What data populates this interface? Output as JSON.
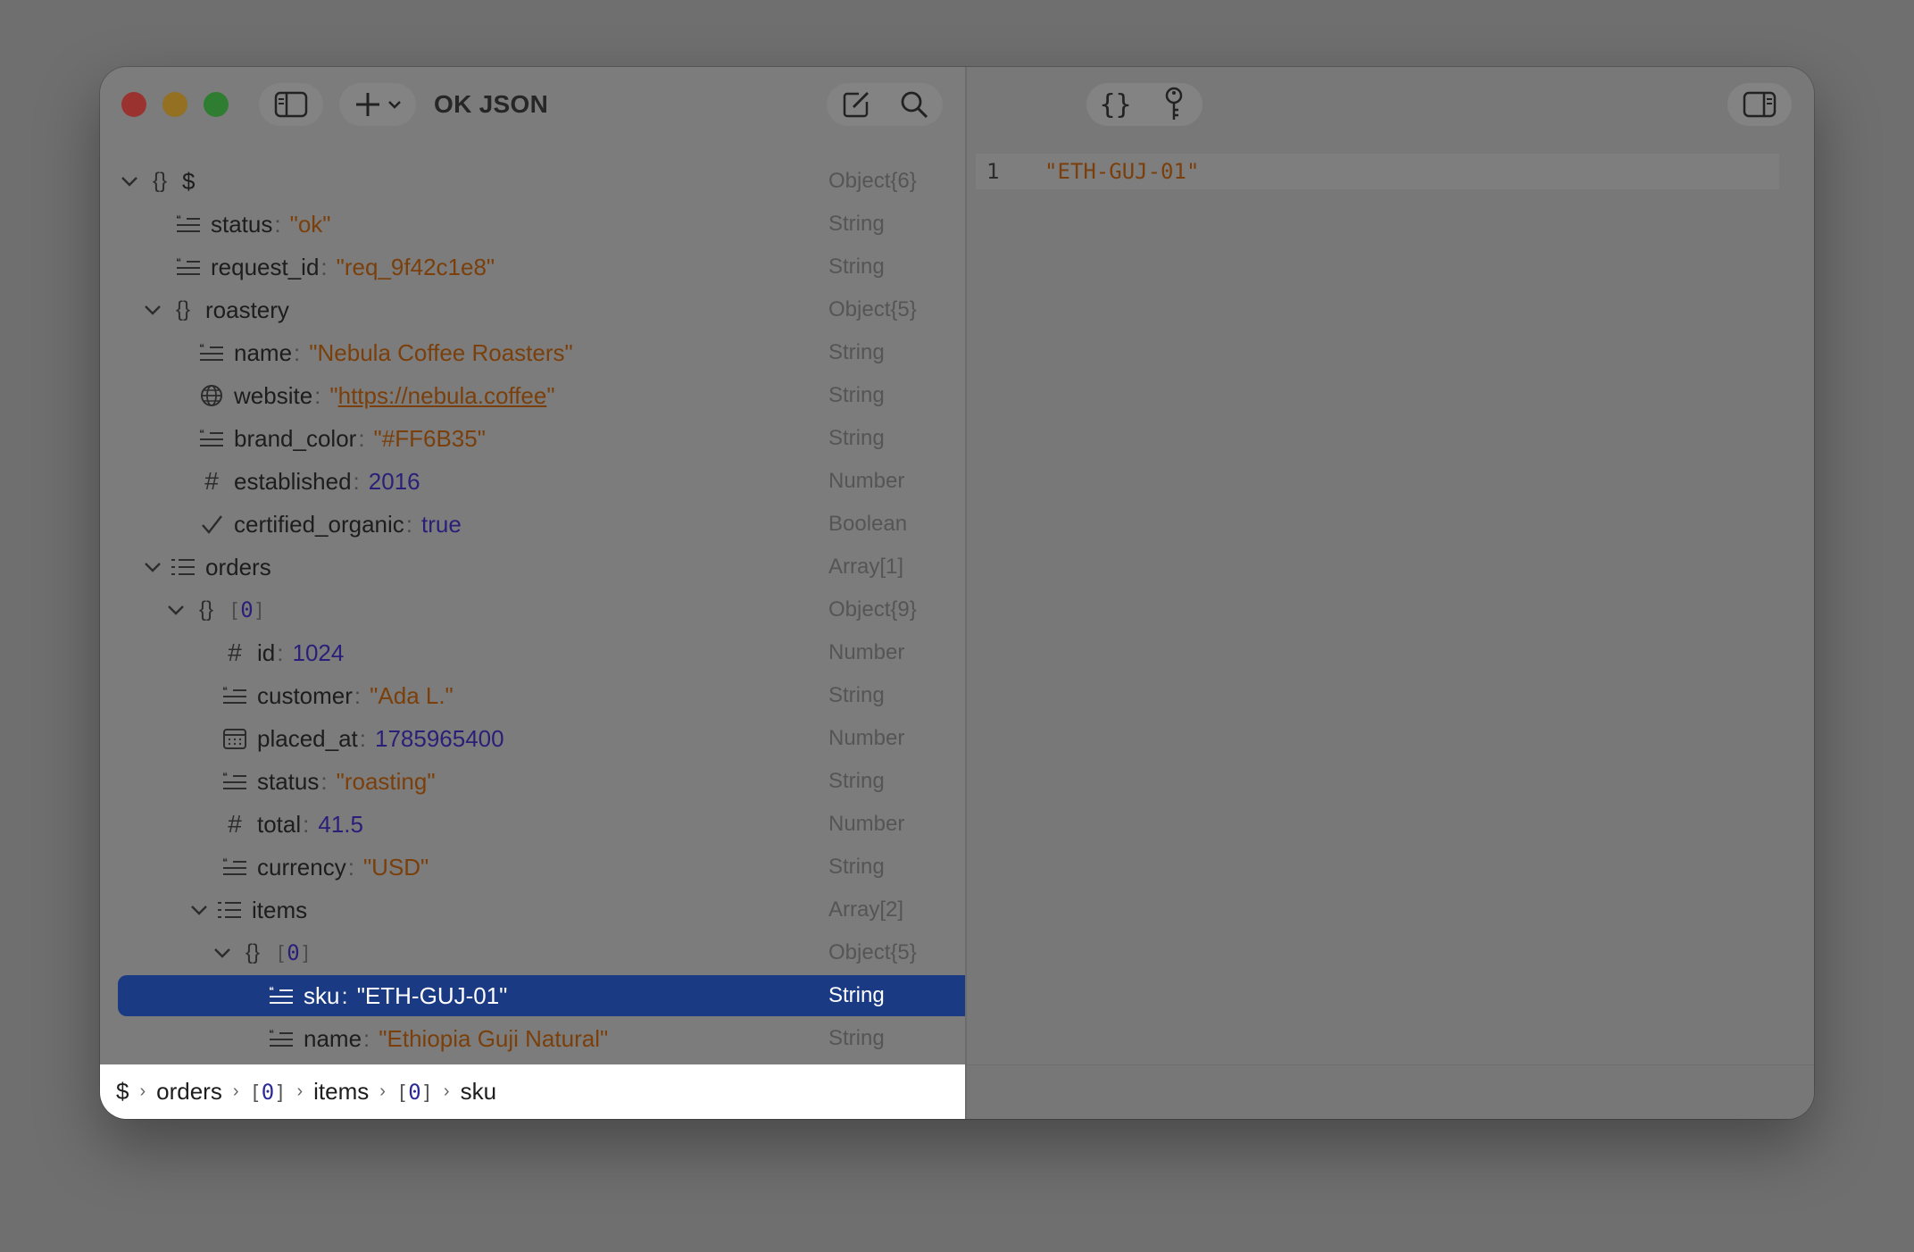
{
  "app": {
    "title": "OK JSON"
  },
  "tree": {
    "rows": [
      {
        "key": "$",
        "type": "Object{6}"
      },
      {
        "key": "status",
        "value": "\"ok\"",
        "type": "String"
      },
      {
        "key": "request_id",
        "value": "\"req_9f42c1e8\"",
        "type": "String"
      },
      {
        "key": "roastery",
        "type": "Object{5}"
      },
      {
        "key": "name",
        "value": "\"Nebula Coffee Roasters\"",
        "type": "String"
      },
      {
        "key": "website",
        "value_prefix": "\"",
        "value": "https://nebula.coffee",
        "value_suffix": "\"",
        "type": "String"
      },
      {
        "key": "brand_color",
        "value": "\"#FF6B35\"",
        "type": "String"
      },
      {
        "key": "established",
        "value": "2016",
        "type": "Number"
      },
      {
        "key": "certified_organic",
        "value": "true",
        "type": "Boolean"
      },
      {
        "key": "orders",
        "type": "Array[1]"
      },
      {
        "index_open": "[",
        "index": "0",
        "index_close": "]",
        "type": "Object{9}"
      },
      {
        "key": "id",
        "value": "1024",
        "type": "Number"
      },
      {
        "key": "customer",
        "value": "\"Ada L.\"",
        "type": "String"
      },
      {
        "key": "placed_at",
        "value": "1785965400",
        "type": "Number"
      },
      {
        "key": "status",
        "value": "\"roasting\"",
        "type": "String"
      },
      {
        "key": "total",
        "value": "41.5",
        "type": "Number"
      },
      {
        "key": "currency",
        "value": "\"USD\"",
        "type": "String"
      },
      {
        "key": "items",
        "type": "Array[2]"
      },
      {
        "index_open": "[",
        "index": "0",
        "index_close": "]",
        "type": "Object{5}"
      },
      {
        "key": "sku",
        "value": "\"ETH-GUJ-01\"",
        "type": "String"
      },
      {
        "key": "name",
        "value": "\"Ethiopia Guji Natural\"",
        "type": "String"
      }
    ]
  },
  "breadcrumb": {
    "root": "$",
    "separator": "›",
    "orders": "orders",
    "idx1_open": "[",
    "idx1": "0",
    "idx1_close": "]",
    "items": "items",
    "idx2_open": "[",
    "idx2": "0",
    "idx2_close": "]",
    "sku": "sku"
  },
  "editor": {
    "line_number": "1",
    "line_text": "\"ETH-GUJ-01\""
  },
  "icons": {
    "sidebar_toggle": "sidebar-icon",
    "add": "plus-icon",
    "edit": "compose-icon",
    "search": "search-icon",
    "format": "braces-icon",
    "keys": "key-icon",
    "inspector": "inspector-icon"
  },
  "colors": {
    "selection": "#1b3a84",
    "string_value": "#7a3f0a",
    "number_value": "#2a1f78"
  }
}
